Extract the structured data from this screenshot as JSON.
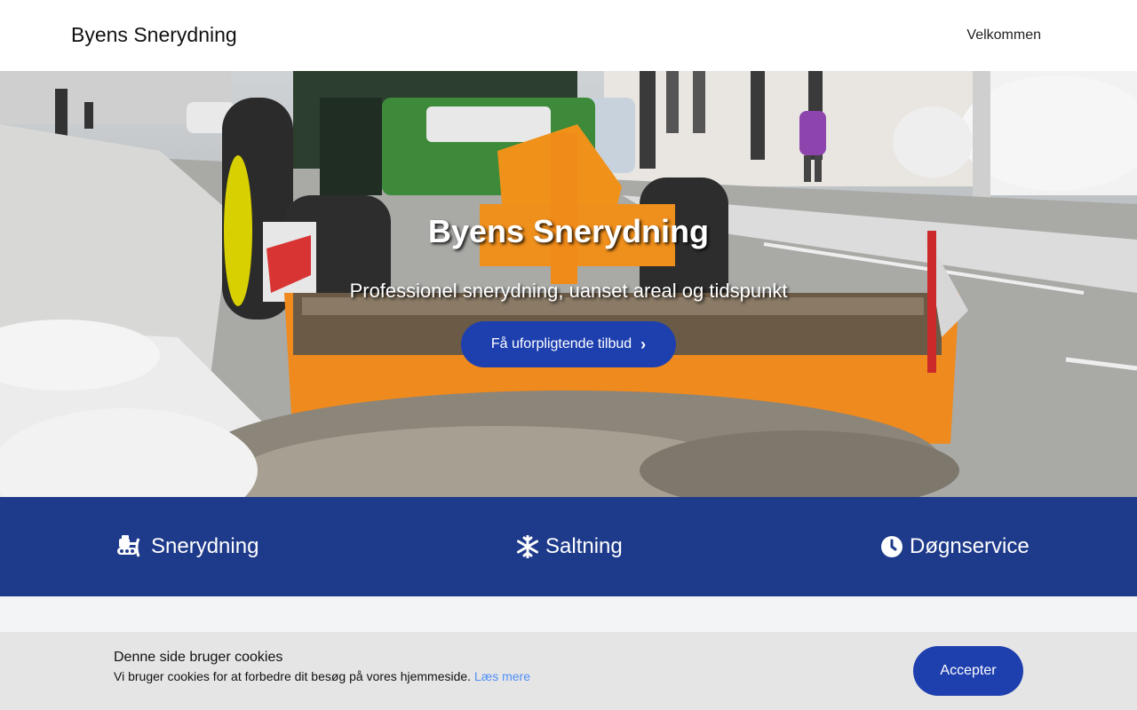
{
  "header": {
    "brand": "Byens Snerydning",
    "nav": [
      {
        "label": "Velkommen"
      }
    ]
  },
  "hero": {
    "title": "Byens Snerydning",
    "subtitle": "Professionel snerydning, uanset areal og tidspunkt",
    "cta_label": "Få uforpligtende tilbud",
    "cta_icon": "chevron-right-icon",
    "image": "snow-plow-tractor-photo"
  },
  "features": [
    {
      "label": "Snerydning",
      "icon": "snow-plow-icon"
    },
    {
      "label": "Saltning",
      "icon": "snowflake-icon"
    },
    {
      "label": "Døgnservice",
      "icon": "clock-icon"
    }
  ],
  "cookie": {
    "title": "Denne side bruger cookies",
    "text": "Vi bruger cookies for at forbedre dit besøg på vores hjemmeside.",
    "link_label": "Læs mere",
    "accept_label": "Accepter"
  },
  "colors": {
    "primary": "#1e40af",
    "features_bg": "#1e3a8a",
    "cookie_bg": "#e5e5e5",
    "link": "#4f8ef7"
  }
}
